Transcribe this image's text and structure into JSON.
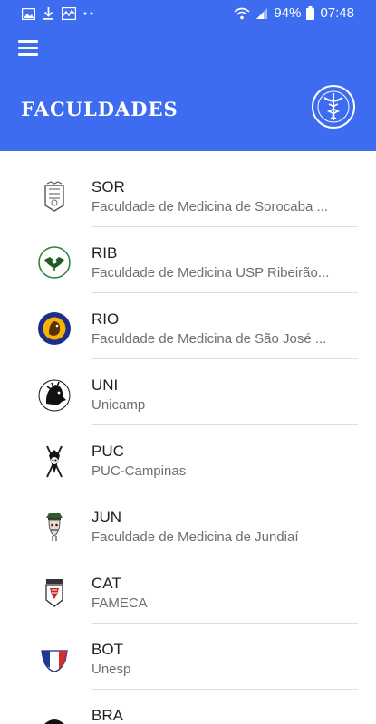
{
  "status_bar": {
    "battery": "94%",
    "time": "07:48",
    "icons": [
      "image-icon",
      "download-icon",
      "activity-icon",
      "more-dots-icon",
      "wifi-icon",
      "signal-icon",
      "battery-icon"
    ]
  },
  "header": {
    "title": "FACULDADES",
    "menu_icon": "hamburger-menu-icon",
    "crest_icon": "medical-crest-icon",
    "color": "#3d6cf0"
  },
  "faculdades": [
    {
      "code": "SOR",
      "name": "Faculdade de Medicina de Sorocaba ...",
      "logo": "sor-logo-icon"
    },
    {
      "code": "RIB",
      "name": "Faculdade de Medicina USP Ribeirão...",
      "logo": "rib-logo-icon"
    },
    {
      "code": "RIO",
      "name": "Faculdade de Medicina de São José ...",
      "logo": "rio-logo-icon"
    },
    {
      "code": "UNI",
      "name": "Unicamp",
      "logo": "uni-logo-icon"
    },
    {
      "code": "PUC",
      "name": "PUC-Campinas",
      "logo": "puc-logo-icon"
    },
    {
      "code": "JUN",
      "name": "Faculdade de Medicina de Jundiaí",
      "logo": "jun-logo-icon"
    },
    {
      "code": "CAT",
      "name": "FAMECA",
      "logo": "cat-logo-icon"
    },
    {
      "code": "BOT",
      "name": "Unesp",
      "logo": "bot-logo-icon"
    },
    {
      "code": "BRA",
      "name": "",
      "logo": "bra-logo-icon"
    }
  ]
}
